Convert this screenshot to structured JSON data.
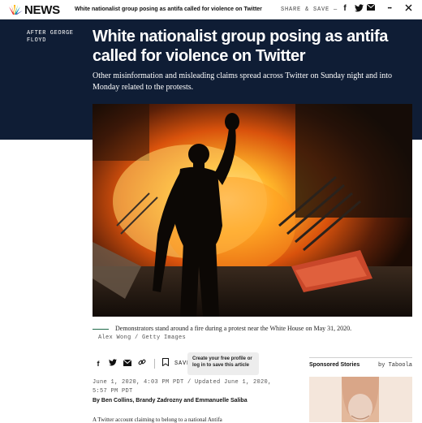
{
  "topbar": {
    "brand": "NEWS",
    "headline": "White nationalist group posing as antifa called for violence on Twitter",
    "share_label": "SHARE & SAVE —",
    "icons": [
      "facebook-icon",
      "twitter-icon",
      "email-icon",
      "more-icon",
      "close-icon"
    ],
    "more_glyph": "•••"
  },
  "article": {
    "kicker": "AFTER GEORGE FLOYD",
    "title": "White nationalist group posing as antifa called for violence on Twitter",
    "dek": "Other misinformation and misleading claims spread across Twitter on Sunday night and into Monday related to the protests.",
    "caption": "Demonstrators stand around a fire during a protest near the White House on May 31, 2020.",
    "credit": "Alex Wong / Getty Images",
    "save_label": "SAVE",
    "tooltip": "Create your free profile or log in to save this article",
    "dateline": "June 1, 2020, 4:03 PM PDT / Updated June 1, 2020, 5:57 PM PDT",
    "byline": "By Ben Collins, Brandy Zadrozny and Emmanuelle Saliba",
    "body_snippet": "A Twitter account claiming to belong to a national Antifa"
  },
  "sidebar": {
    "sponsored_label": "Sponsored Stories",
    "provider": "by Taboola"
  },
  "colors": {
    "hero_bg": "#0f1d35",
    "caption_rule": "#1f6b4a"
  }
}
